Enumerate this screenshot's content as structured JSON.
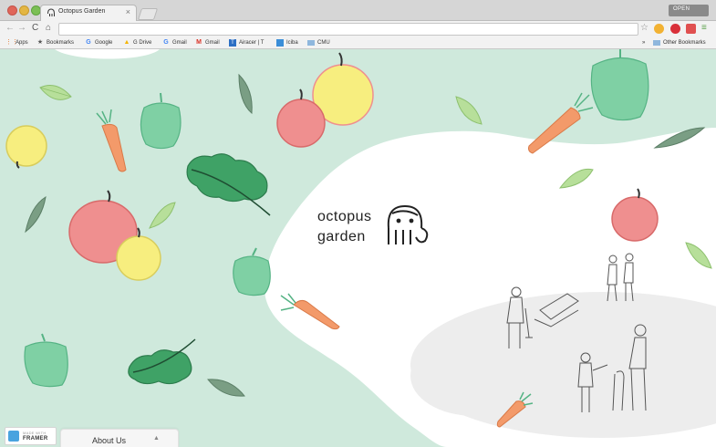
{
  "browser": {
    "tab_title": "Octopus Garden",
    "tab_close": "×",
    "profile_label": "OPEN",
    "bookmarks": [
      {
        "label": "Apps",
        "icon": "apps-grid-icon"
      },
      {
        "label": "Bookmarks",
        "icon": "star-icon"
      },
      {
        "label": "Google",
        "icon": "google-icon"
      },
      {
        "label": "G Drive",
        "icon": "drive-icon"
      },
      {
        "label": "Gmail",
        "icon": "google-icon"
      },
      {
        "label": "Gmail",
        "icon": "gmail-icon"
      },
      {
        "label": "Airacer | T",
        "icon": "page-icon"
      },
      {
        "label": "Iciba",
        "icon": "page-icon"
      },
      {
        "label": "CMU",
        "icon": "folder-icon"
      }
    ],
    "overflow_label": "»",
    "other_bookmarks": "Other Bookmarks"
  },
  "site": {
    "logo_line1": "octopus",
    "logo_line2": "garden"
  },
  "framer_badge": {
    "top": "MADE WITH",
    "bottom": "FRAMER"
  },
  "about_tab": {
    "label": "About Us",
    "caret": "▲"
  },
  "colors": {
    "mint": "#cfe9dc",
    "pepper": "#7fd0a4",
    "apple_red": "#ef8f8f",
    "apple_yellow": "#f7ee7f",
    "carrot": "#f39a6a",
    "leaf": "#b7df9a",
    "gray_ground": "#ededed"
  }
}
